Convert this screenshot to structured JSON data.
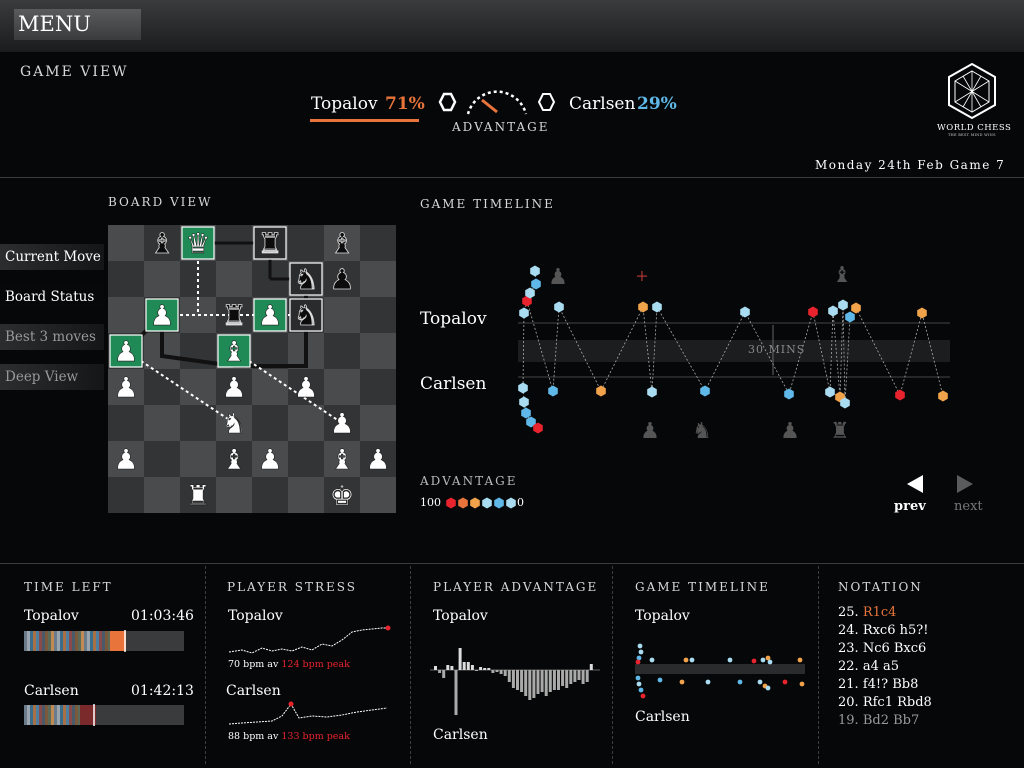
{
  "menu": {
    "label": "MENU"
  },
  "header": {
    "section_title": "GAME VIEW",
    "player1": {
      "name": "Topalov",
      "percent": "71%"
    },
    "player2": {
      "name": "Carlsen",
      "percent": "29%"
    },
    "gauge_label": "ADVANTAGE",
    "logo_text": "WORLD CHESS",
    "logo_sub": "THE BEST MIND WINS",
    "date": "Monday 24th Feb Game 7"
  },
  "colors": {
    "orange": "#e8743b",
    "blue": "#5fb8e8",
    "green": "#1f8a55",
    "red": "#e8232e"
  },
  "board": {
    "title": "BOARD VIEW",
    "pieces": [
      {
        "sq": "b8",
        "p": "bishop-black"
      },
      {
        "sq": "c8",
        "p": "queen-black"
      },
      {
        "sq": "e8",
        "p": "rook-black"
      },
      {
        "sq": "g8",
        "p": "bishop-black"
      },
      {
        "sq": "f7",
        "p": "knight-black"
      },
      {
        "sq": "g7",
        "p": "pawn-black"
      },
      {
        "sq": "b6",
        "p": "pawn-black"
      },
      {
        "sq": "d6",
        "p": "rook-black"
      },
      {
        "sq": "e6",
        "p": "pawn-black"
      },
      {
        "sq": "f6",
        "p": "knight-black"
      },
      {
        "sq": "a5",
        "p": "pawn-black"
      },
      {
        "sq": "d5",
        "p": "bishop-black"
      },
      {
        "sq": "a4",
        "p": "pawn-white"
      },
      {
        "sq": "d4",
        "p": "pawn-white"
      },
      {
        "sq": "f4",
        "p": "pawn-white"
      },
      {
        "sq": "d3",
        "p": "knight-white"
      },
      {
        "sq": "g3",
        "p": "pawn-white"
      },
      {
        "sq": "a2",
        "p": "pawn-white"
      },
      {
        "sq": "d2",
        "p": "bishop-white"
      },
      {
        "sq": "e2",
        "p": "pawn-white"
      },
      {
        "sq": "g2",
        "p": "bishop-white"
      },
      {
        "sq": "h2",
        "p": "pawn-white"
      },
      {
        "sq": "c1",
        "p": "rook-white"
      },
      {
        "sq": "g1",
        "p": "king-white"
      }
    ],
    "highlights": [
      "c8",
      "e8",
      "f7",
      "b6",
      "e6",
      "a5",
      "d5",
      "f6"
    ]
  },
  "sidebar": {
    "items": [
      {
        "label": "Current Move"
      },
      {
        "label": "Board Status"
      },
      {
        "label": "Best 3 moves"
      },
      {
        "label": "Deep View"
      }
    ]
  },
  "timeline": {
    "title": "GAME TIMELINE",
    "player1": "Topalov",
    "player2": "Carlsen",
    "band_label": "30 MINS",
    "legend_title": "ADVANTAGE",
    "legend_max": "100",
    "legend_min": "0",
    "prev": "prev",
    "next": "next"
  },
  "time_left": {
    "title": "TIME LEFT",
    "player1": {
      "name": "Topalov",
      "time": "01:03:46"
    },
    "player2": {
      "name": "Carlsen",
      "time": "01:42:13"
    }
  },
  "stress": {
    "title": "PLAYER STRESS",
    "player1": {
      "name": "Topalov",
      "avg": "70 bpm av",
      "peak": "124 bpm peak"
    },
    "player2": {
      "name": "Carlsen",
      "avg": "88 bpm av",
      "peak": "133 bpm peak"
    }
  },
  "advantage_panel": {
    "title": "PLAYER ADVANTAGE",
    "player1": "Topalov",
    "player2": "Carlsen"
  },
  "timeline_mini": {
    "title": "GAME TIMELINE",
    "player1": "Topalov",
    "player2": "Carlsen"
  },
  "notation": {
    "title": "NOTATION",
    "moves": [
      {
        "num": "25.",
        "text": "R1c4",
        "current": true
      },
      {
        "num": "24.",
        "text": "Rxc6 h5?!"
      },
      {
        "num": "23.",
        "text": "Nc6 Bxc6"
      },
      {
        "num": "22.",
        "text": "a4 a5"
      },
      {
        "num": "21.",
        "text": "f4!? Bb8"
      },
      {
        "num": "20.",
        "text": "Rfc1 Rbd8"
      },
      {
        "num": "19.",
        "text": "Bd2 Bb7"
      }
    ]
  }
}
